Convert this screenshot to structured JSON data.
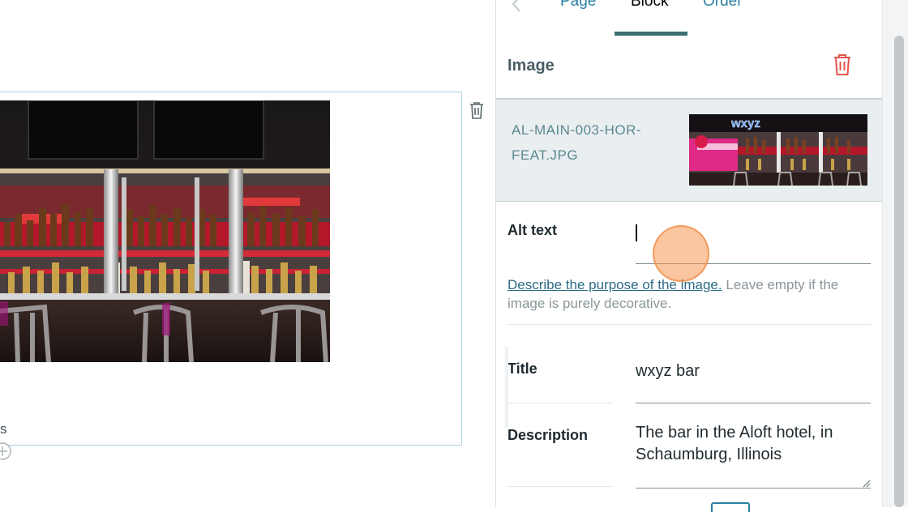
{
  "tabs": {
    "page": "Page",
    "block": "Block",
    "order": "Order"
  },
  "section": {
    "title": "Image"
  },
  "image": {
    "filename": "AL-MAIN-003-HOR-FEAT.JPG",
    "thumb_sign": "wxyz"
  },
  "alt_text": {
    "label": "Alt text",
    "value": "",
    "help_link": "Describe the purpose of the image.",
    "help_rest": " Leave empty if the image is purely decorative."
  },
  "title_field": {
    "label": "Title",
    "value": "wxyz bar"
  },
  "description_field": {
    "label": "Description",
    "value": "The bar in the Aloft hotel, in Schaumburg, Illinois"
  },
  "canvas": {
    "caption_fragment": "s"
  },
  "colors": {
    "accent": "#2b7fa3",
    "danger": "#e5534b",
    "tab_indicator": "#3b6e73"
  }
}
